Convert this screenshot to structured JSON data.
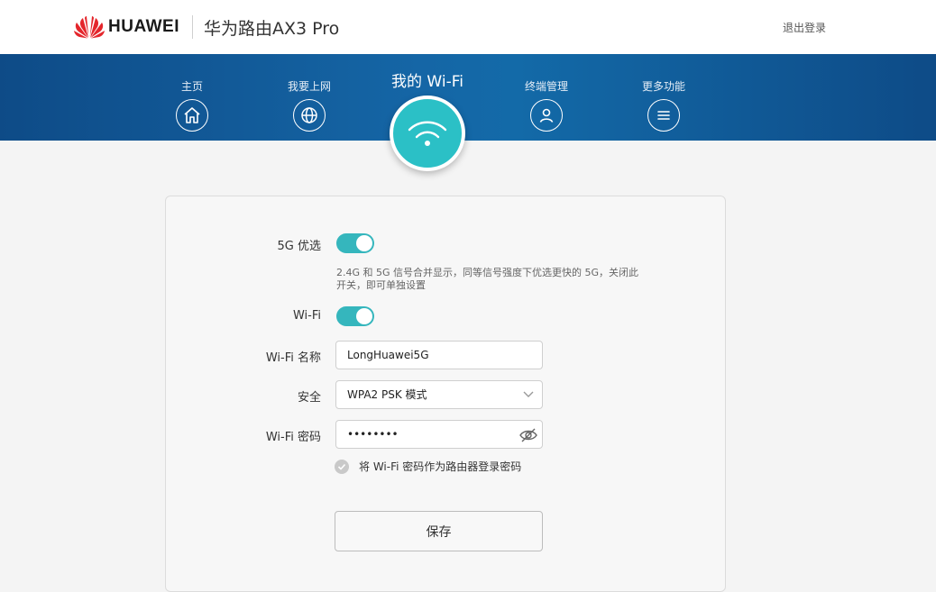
{
  "header": {
    "brand": "HUAWEI",
    "product": "华为路由AX3 Pro",
    "logout": "退出登录"
  },
  "nav": {
    "items": [
      {
        "label": "主页",
        "icon": "home-icon"
      },
      {
        "label": "我要上网",
        "icon": "globe-icon"
      },
      {
        "label": "我的 Wi-Fi",
        "icon": "wifi-icon",
        "active": true
      },
      {
        "label": "终端管理",
        "icon": "user-icon"
      },
      {
        "label": "更多功能",
        "icon": "menu-icon"
      }
    ]
  },
  "form": {
    "band_priority": {
      "label": "5G 优选",
      "enabled": true
    },
    "band_hint": "2.4G 和 5G 信号合并显示，同等信号强度下优选更快的 5G，关闭此开关，即可单独设置",
    "wifi": {
      "label": "Wi-Fi",
      "enabled": true
    },
    "ssid": {
      "label": "Wi-Fi 名称",
      "value": "LongHuawei5G"
    },
    "security": {
      "label": "安全",
      "value": "WPA2 PSK 模式"
    },
    "password": {
      "label": "Wi-Fi 密码",
      "value": "••••••••"
    },
    "use_as_login": {
      "label": "将 Wi-Fi 密码作为路由器登录密码",
      "checked": true
    },
    "save_label": "保存"
  },
  "colors": {
    "accent": "#35b6bd",
    "nav_band": "#1566a6",
    "brand_red": "#e4262c"
  }
}
